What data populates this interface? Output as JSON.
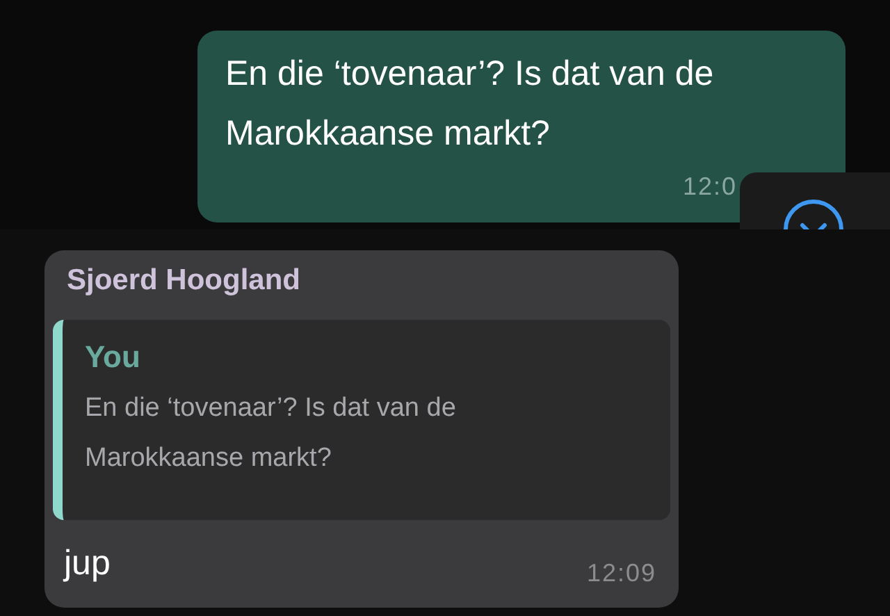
{
  "outgoing": {
    "text": "En die ‘tovenaar’? Is dat van de Marokkaanse markt?",
    "time": "12:0"
  },
  "incoming": {
    "sender": "Sjoerd Hoogland",
    "quote": {
      "author": "You",
      "text": "En die ‘tovenaar’? Is dat van de Marokkaanse markt?"
    },
    "text": "jup",
    "time": "12:09"
  }
}
